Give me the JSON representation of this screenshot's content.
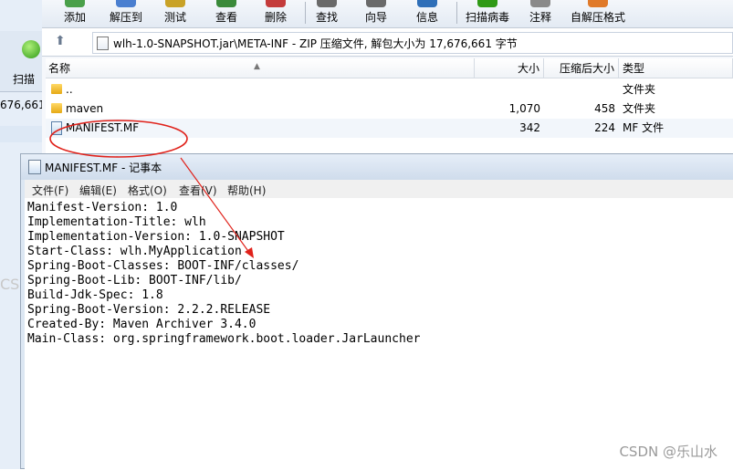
{
  "background_window": {
    "scan_label": "扫描",
    "size_fragment": "676,661",
    "watermark_fragment": "CS"
  },
  "toolbar": {
    "buttons": [
      {
        "label": "添加",
        "color": "#4aa04a"
      },
      {
        "label": "解压到",
        "color": "#4a7fd0"
      },
      {
        "label": "测试",
        "color": "#c9a227"
      },
      {
        "label": "查看",
        "color": "#3a8a3a"
      },
      {
        "label": "删除",
        "color": "#c43b3b"
      },
      {
        "label": "查找",
        "color": "#6a6a6a"
      },
      {
        "label": "向导",
        "color": "#6a6a6a"
      },
      {
        "label": "信息",
        "color": "#2f6fb8"
      },
      {
        "label": "扫描病毒",
        "color": "#2f9a16"
      },
      {
        "label": "注释",
        "color": "#8a8a8a"
      },
      {
        "label": "自解压格式",
        "color": "#e07a2a"
      }
    ]
  },
  "address_bar": {
    "path": "wlh-1.0-SNAPSHOT.jar\\META-INF - ZIP 压缩文件, 解包大小为 17,676,661 字节"
  },
  "file_list": {
    "columns": [
      "名称",
      "大小",
      "压缩后大小",
      "类型"
    ],
    "rows": [
      {
        "name": "..",
        "size": "",
        "packed": "",
        "type": "文件夹",
        "icon": "folder-icon"
      },
      {
        "name": "maven",
        "size": "1,070",
        "packed": "458",
        "type": "文件夹",
        "icon": "folder-icon"
      },
      {
        "name": "MANIFEST.MF",
        "size": "342",
        "packed": "224",
        "type": "MF 文件",
        "icon": "mf-file-icon"
      }
    ]
  },
  "notepad": {
    "title": "MANIFEST.MF - 记事本",
    "menu": [
      "文件(F)",
      "编辑(E)",
      "格式(O)",
      "查看(V)",
      "帮助(H)"
    ],
    "content": "Manifest-Version: 1.0\nImplementation-Title: wlh\nImplementation-Version: 1.0-SNAPSHOT\nStart-Class: wlh.MyApplication\nSpring-Boot-Classes: BOOT-INF/classes/\nSpring-Boot-Lib: BOOT-INF/lib/\nBuild-Jdk-Spec: 1.8\nSpring-Boot-Version: 2.2.2.RELEASE\nCreated-By: Maven Archiver 3.4.0\nMain-Class: org.springframework.boot.loader.JarLauncher"
  },
  "watermark": "CSDN @乐山水",
  "annotation_color": "#e0221b"
}
